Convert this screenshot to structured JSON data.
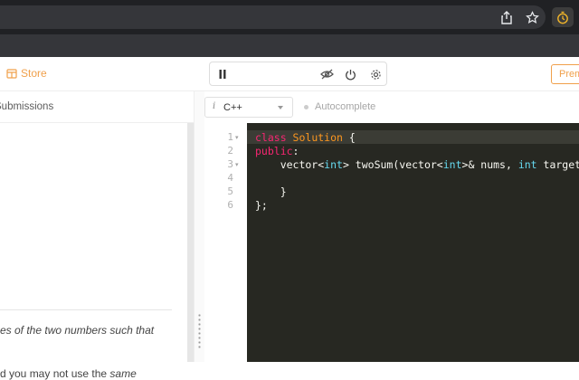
{
  "browser": {
    "icons": [
      "share-icon",
      "star-icon",
      "timer-extension-icon"
    ]
  },
  "header": {
    "store_label": "Store",
    "premium_label": "Premium",
    "timer_icons": [
      "pause-icon",
      "eye-off-icon",
      "power-icon",
      "gear-icon"
    ]
  },
  "left": {
    "tab_label": "Submissions",
    "description_lines": [
      {
        "segments": [
          {
            "text": "es of the two numbers such that",
            "italic": true
          }
        ]
      },
      {
        "segments": [
          {
            "text": "d you may not use the ",
            "italic": false
          },
          {
            "text": "same",
            "italic": true
          }
        ]
      }
    ]
  },
  "editor": {
    "language": "C++",
    "language_info_glyph": "i",
    "autocomplete_label": "Autocomplete",
    "line_numbers": [
      "1",
      "2",
      "3",
      "4",
      "5",
      "6"
    ],
    "fold_markers": [
      "▾",
      "",
      "▾",
      "",
      "",
      ""
    ],
    "code_lines": [
      [
        {
          "t": "class ",
          "c": "kw"
        },
        {
          "t": "Solution",
          "c": "cls"
        },
        {
          "t": " {",
          "c": "pl"
        }
      ],
      [
        {
          "t": "public",
          "c": "kw"
        },
        {
          "t": ":",
          "c": "pl"
        }
      ],
      [
        {
          "t": "    vector<",
          "c": "pl"
        },
        {
          "t": "int",
          "c": "ty"
        },
        {
          "t": "> twoSum(vector<",
          "c": "pl"
        },
        {
          "t": "int",
          "c": "ty"
        },
        {
          "t": ">& nums, ",
          "c": "pl"
        },
        {
          "t": "int",
          "c": "ty"
        },
        {
          "t": " target) {",
          "c": "pl"
        }
      ],
      [
        {
          "t": "",
          "c": "pl"
        }
      ],
      [
        {
          "t": "    }",
          "c": "pl"
        }
      ],
      [
        {
          "t": "};",
          "c": "pl"
        }
      ]
    ],
    "theme_colors": {
      "background": "#272822",
      "keyword": "#f92672",
      "class_name": "#fd971f",
      "type": "#66d9ef",
      "plain": "#f8f8f2"
    }
  },
  "colors": {
    "accent": "#f0a04b",
    "chrome_dark": "#202124"
  }
}
